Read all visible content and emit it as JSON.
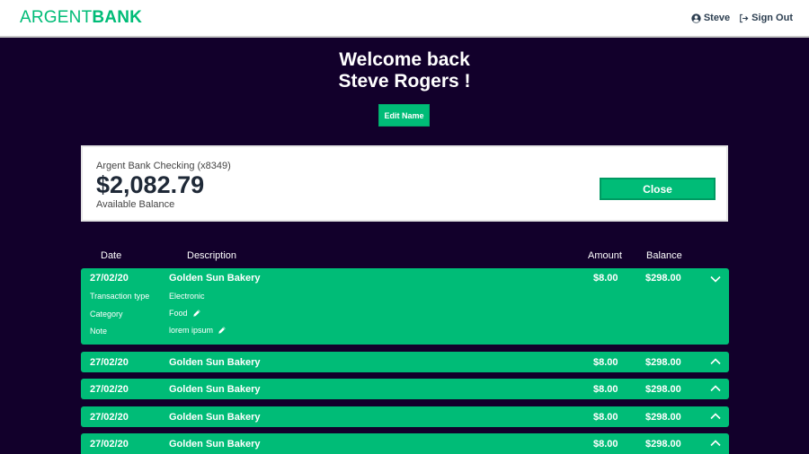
{
  "header": {
    "logo_part1": "ARGENT",
    "logo_part2": "BANK",
    "user_name": "Steve",
    "signout_label": "Sign Out",
    "user_icon": "user-circle-icon",
    "signout_icon": "sign-out-icon"
  },
  "welcome": {
    "line1": "Welcome back",
    "line2": "Steve Rogers !",
    "edit_label": "Edit Name"
  },
  "account": {
    "title": "Argent Bank Checking (x8349)",
    "amount": "$2,082.79",
    "description": "Available Balance",
    "close_label": "Close"
  },
  "table": {
    "headers": {
      "date": "Date",
      "description": "Description",
      "amount": "Amount",
      "balance": "Balance"
    },
    "transactions": [
      {
        "date": "27/02/20",
        "description": "Golden Sun Bakery",
        "amount": "$8.00",
        "balance": "$298.00",
        "expanded": true,
        "details": {
          "type_label": "Transaction type",
          "type_value": "Electronic",
          "category_label": "Category",
          "category_value": "Food",
          "note_label": "Note",
          "note_value": "lorem ipsum"
        }
      },
      {
        "date": "27/02/20",
        "description": "Golden Sun Bakery",
        "amount": "$8.00",
        "balance": "$298.00",
        "expanded": false
      },
      {
        "date": "27/02/20",
        "description": "Golden Sun Bakery",
        "amount": "$8.00",
        "balance": "$298.00",
        "expanded": false
      },
      {
        "date": "27/02/20",
        "description": "Golden Sun Bakery",
        "amount": "$8.00",
        "balance": "$298.00",
        "expanded": false
      },
      {
        "date": "27/02/20",
        "description": "Golden Sun Bakery",
        "amount": "$8.00",
        "balance": "$298.00",
        "expanded": false
      }
    ]
  },
  "colors": {
    "accent": "#00bc77",
    "background": "#12002b",
    "text_dark": "#2c3e50"
  }
}
